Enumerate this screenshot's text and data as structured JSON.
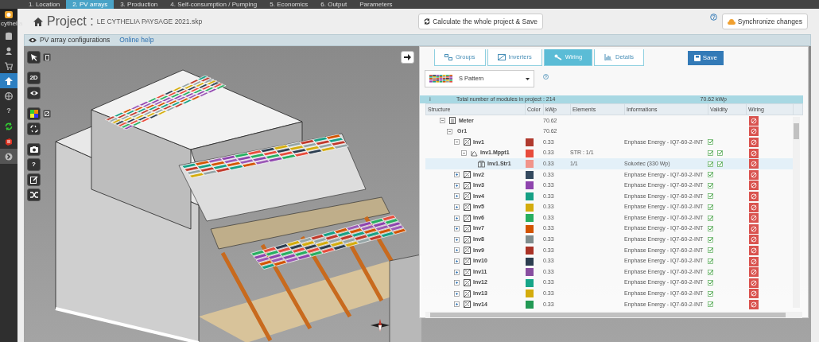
{
  "top_nav": {
    "tabs": [
      {
        "label": "1. Location",
        "selected": false
      },
      {
        "label": "2. PV arrays",
        "selected": true
      },
      {
        "label": "3. Production",
        "selected": false
      },
      {
        "label": "4. Self-consumption / Pumping",
        "selected": false
      },
      {
        "label": "5. Economics",
        "selected": false
      },
      {
        "label": "6. Output",
        "selected": false
      },
      {
        "label": "Parameters",
        "selected": false
      }
    ]
  },
  "sidebar": {
    "logo_text": "cythelia",
    "help": "?"
  },
  "header": {
    "title": "Project :",
    "filename": "LE CYTHELIA PAYSAGE 2021.skp",
    "calculate_button": "Calculate the whole project & Save",
    "sync_button": "Synchronize changes"
  },
  "section_bar": {
    "title": "PV array configurations",
    "help_link": "Online help"
  },
  "view_toolbar": {
    "mode_button": "2D",
    "help_button": "?"
  },
  "panel": {
    "tabs": [
      {
        "label": "Groups",
        "selected": false
      },
      {
        "label": "Inverters",
        "selected": false
      },
      {
        "label": "Wiring",
        "selected": true
      },
      {
        "label": "Details",
        "selected": false
      }
    ],
    "save_button": "Save",
    "pattern_select": {
      "value": "S Pattern"
    },
    "total": {
      "info_icon": "ℹ",
      "modules": "Total number of modules in project : 214",
      "power": "70.62 kWp"
    },
    "columns": [
      "Structure",
      "Color",
      "kWp",
      "Elements",
      "Informations",
      "Validity",
      "Wiring"
    ],
    "structure": [
      {
        "name": "Meter",
        "kind": "meter",
        "expanded": true,
        "kwp": "70.62",
        "selected": false,
        "children": [
          {
            "name": "Gr1",
            "kind": "group",
            "expanded": true,
            "kwp": "70.62",
            "selected": false,
            "children": [
              {
                "name": "Inv1",
                "kind": "inverter",
                "expanded": true,
                "color": "#b03a2e",
                "kwp": "0.33",
                "info": "Enphase Energy - IQ7-60-2-INT",
                "checks": [
                  true
                ],
                "selected": false,
                "children": [
                  {
                    "name": "Inv1.Mppt1",
                    "kind": "mppt",
                    "expanded": true,
                    "color": "#e74c3c",
                    "kwp": "0.33",
                    "elements": "STR : 1/1",
                    "checks": [
                      true,
                      true
                    ],
                    "selected": false,
                    "children": [
                      {
                        "name": "Inv1.Str1",
                        "kind": "string",
                        "color": "#f1948a",
                        "kwp": "0.33",
                        "elements": "1/1",
                        "info": "Soluxtec (330 Wp)",
                        "checks": [
                          true,
                          true
                        ],
                        "selected": true
                      }
                    ]
                  }
                ]
              },
              {
                "name": "Inv2",
                "kind": "inverter",
                "expanded": false,
                "color": "#34495e",
                "kwp": "0.33",
                "info": "Enphase Energy - IQ7-60-2-INT",
                "checks": [
                  true
                ],
                "selected": false
              },
              {
                "name": "Inv3",
                "kind": "inverter",
                "expanded": false,
                "color": "#8e44ad",
                "kwp": "0.33",
                "info": "Enphase Energy - IQ7-60-2-INT",
                "checks": [
                  true
                ],
                "selected": false
              },
              {
                "name": "Inv4",
                "kind": "inverter",
                "expanded": false,
                "color": "#16a085",
                "kwp": "0.33",
                "info": "Enphase Energy - IQ7-60-2-INT",
                "checks": [
                  true
                ],
                "selected": false
              },
              {
                "name": "Inv5",
                "kind": "inverter",
                "expanded": false,
                "color": "#d4ac0d",
                "kwp": "0.33",
                "info": "Enphase Energy - IQ7-60-2-INT",
                "checks": [
                  true
                ],
                "selected": false
              },
              {
                "name": "Inv6",
                "kind": "inverter",
                "expanded": false,
                "color": "#27ae60",
                "kwp": "0.33",
                "info": "Enphase Energy - IQ7-60-2-INT",
                "checks": [
                  true
                ],
                "selected": false
              },
              {
                "name": "Inv7",
                "kind": "inverter",
                "expanded": false,
                "color": "#d35400",
                "kwp": "0.33",
                "info": "Enphase Energy - IQ7-60-2-INT",
                "checks": [
                  true
                ],
                "selected": false
              },
              {
                "name": "Inv8",
                "kind": "inverter",
                "expanded": false,
                "color": "#7f8c8d",
                "kwp": "0.33",
                "info": "Enphase Energy - IQ7-60-2-INT",
                "checks": [
                  true
                ],
                "selected": false
              },
              {
                "name": "Inv9",
                "kind": "inverter",
                "expanded": false,
                "color": "#a93226",
                "kwp": "0.33",
                "info": "Enphase Energy - IQ7-60-2-INT",
                "checks": [
                  true
                ],
                "selected": false
              },
              {
                "name": "Inv10",
                "kind": "inverter",
                "expanded": false,
                "color": "#2c3e50",
                "kwp": "0.33",
                "info": "Enphase Energy - IQ7-60-2-INT",
                "checks": [
                  true
                ],
                "selected": false
              },
              {
                "name": "Inv11",
                "kind": "inverter",
                "expanded": false,
                "color": "#884ea0",
                "kwp": "0.33",
                "info": "Enphase Energy - IQ7-60-2-INT",
                "checks": [
                  true
                ],
                "selected": false
              },
              {
                "name": "Inv12",
                "kind": "inverter",
                "expanded": false,
                "color": "#17a589",
                "kwp": "0.33",
                "info": "Enphase Energy - IQ7-60-2-INT",
                "checks": [
                  true
                ],
                "selected": false
              },
              {
                "name": "Inv13",
                "kind": "inverter",
                "expanded": false,
                "color": "#d4ac0d",
                "kwp": "0.33",
                "info": "Enphase Energy - IQ7-60-2-INT",
                "checks": [
                  true
                ],
                "selected": false
              },
              {
                "name": "Inv14",
                "kind": "inverter",
                "expanded": false,
                "color": "#229954",
                "kwp": "0.33",
                "info": "Enphase Energy - IQ7-60-2-INT",
                "checks": [
                  true
                ],
                "selected": false
              }
            ]
          }
        ]
      }
    ]
  }
}
